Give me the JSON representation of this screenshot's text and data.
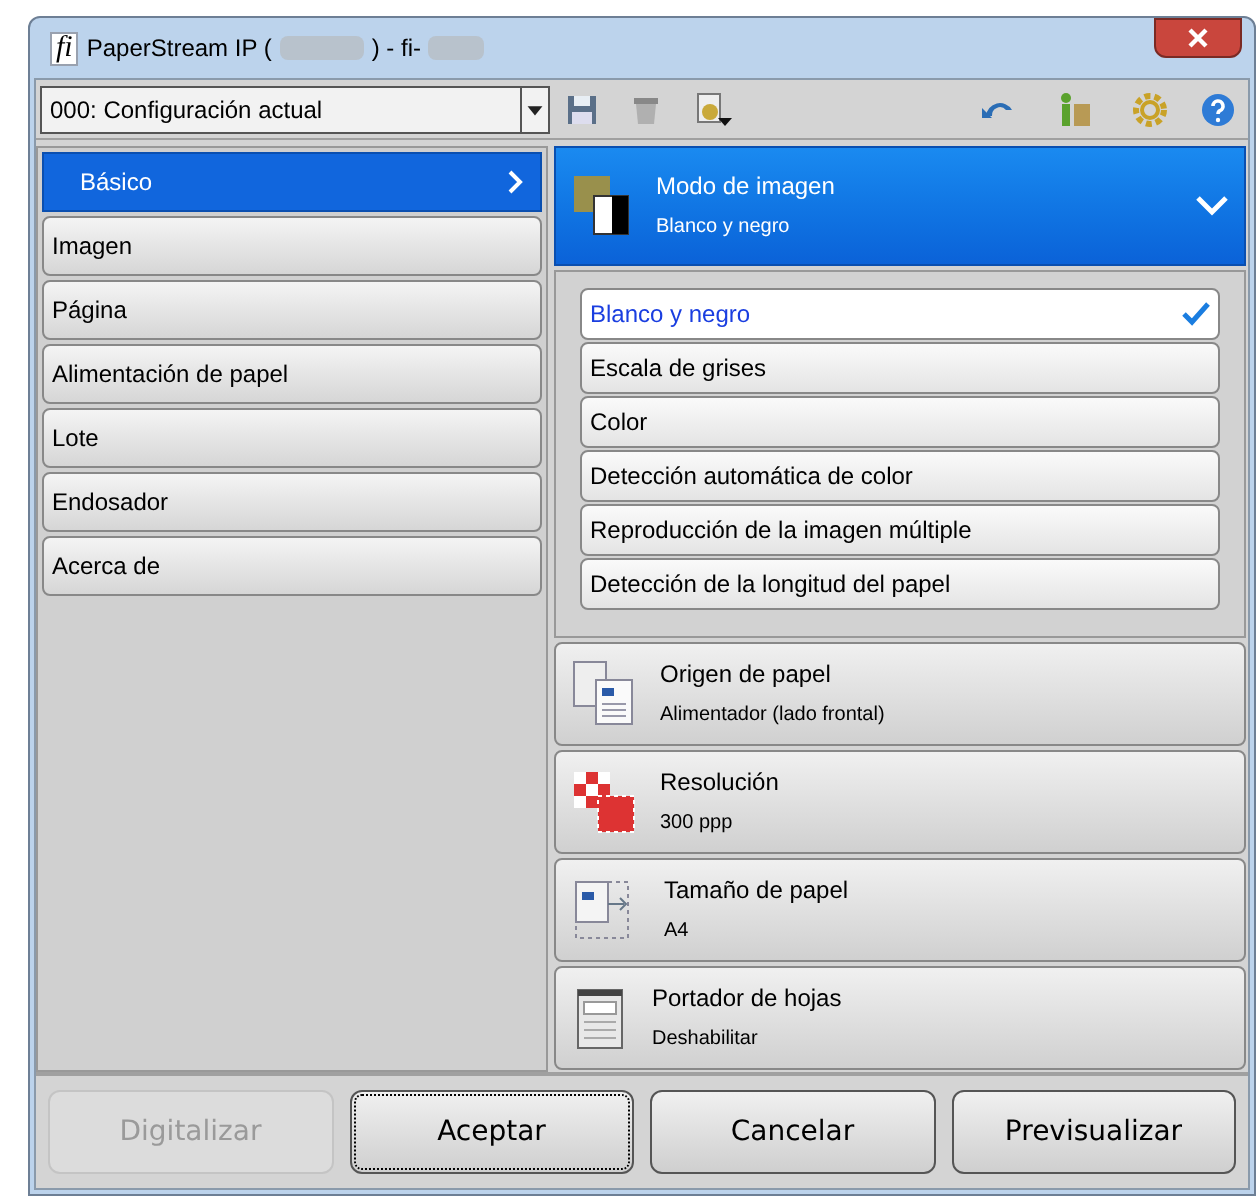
{
  "window": {
    "logo": "fi",
    "title_start": "PaperStream IP (",
    "title_middle": ") - fi-"
  },
  "toolbar": {
    "profile": "000: Configuración actual"
  },
  "sidebar": {
    "items": [
      {
        "label": "Básico",
        "selected": true
      },
      {
        "label": "Imagen",
        "selected": false
      },
      {
        "label": "Página",
        "selected": false
      },
      {
        "label": "Alimentación de papel",
        "selected": false
      },
      {
        "label": "Lote",
        "selected": false
      },
      {
        "label": "Endosador",
        "selected": false
      },
      {
        "label": "Acerca de",
        "selected": false
      }
    ]
  },
  "sections": [
    {
      "kind": "image-mode",
      "title": "Modo de imagen",
      "value": "Blanco y negro",
      "expanded": true,
      "options": [
        {
          "label": "Blanco y negro",
          "selected": true
        },
        {
          "label": "Escala de grises",
          "selected": false
        },
        {
          "label": "Color",
          "selected": false
        },
        {
          "label": "Detección automática de color",
          "selected": false
        },
        {
          "label": "Reproducción de la imagen múltiple",
          "selected": false
        },
        {
          "label": "Detección de la longitud del papel",
          "selected": false
        }
      ]
    },
    {
      "kind": "paper-source",
      "title": "Origen de papel",
      "value": "Alimentador (lado frontal)",
      "expanded": false
    },
    {
      "kind": "resolution",
      "title": "Resolución",
      "value": "300 ppp",
      "expanded": false
    },
    {
      "kind": "paper-size",
      "title": "Tamaño de papel",
      "value": "A4",
      "expanded": false
    },
    {
      "kind": "carrier",
      "title": "Portador de hojas",
      "value": "Deshabilitar",
      "expanded": false
    }
  ],
  "buttons": [
    {
      "label": "Digitalizar",
      "disabled": true,
      "focused": false
    },
    {
      "label": "Aceptar",
      "disabled": false,
      "focused": true
    },
    {
      "label": "Cancelar",
      "disabled": false,
      "focused": false
    },
    {
      "label": "Previsualizar",
      "disabled": false,
      "focused": false
    }
  ]
}
